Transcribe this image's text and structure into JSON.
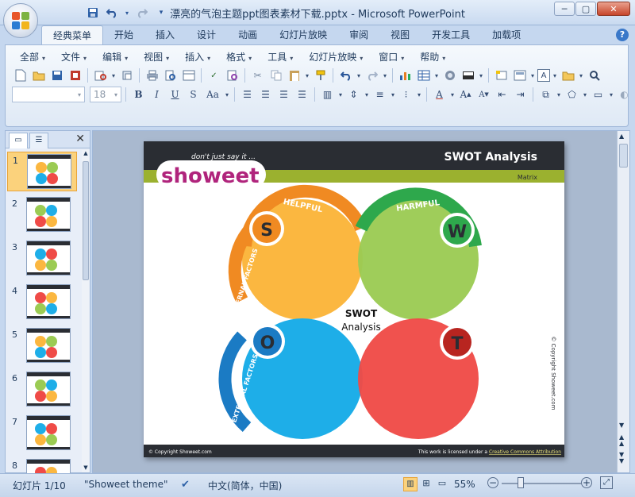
{
  "window": {
    "title": "漂亮的气泡主题ppt图表素材下载.pptx - Microsoft PowerPoint",
    "controls": {
      "minimize": "─",
      "maximize": "▢",
      "close": "✕"
    }
  },
  "quick_access": [
    "save-icon",
    "undo-icon",
    "redo-icon",
    "customize-icon"
  ],
  "ribbon_tabs": [
    {
      "label": "经典菜单",
      "active": true
    },
    {
      "label": "开始"
    },
    {
      "label": "插入"
    },
    {
      "label": "设计"
    },
    {
      "label": "动画"
    },
    {
      "label": "幻灯片放映"
    },
    {
      "label": "审阅"
    },
    {
      "label": "视图"
    },
    {
      "label": "开发工具"
    },
    {
      "label": "加载项"
    }
  ],
  "classic_menu": [
    {
      "label": "全部"
    },
    {
      "label": "文件"
    },
    {
      "label": "编辑"
    },
    {
      "label": "视图"
    },
    {
      "label": "插入"
    },
    {
      "label": "格式"
    },
    {
      "label": "工具"
    },
    {
      "label": "幻灯片放映"
    },
    {
      "label": "窗口"
    },
    {
      "label": "帮助"
    }
  ],
  "font_box": {
    "name": "",
    "size": "18"
  },
  "slide_pane": {
    "thumbnails": [
      {
        "num": "1",
        "selected": true
      },
      {
        "num": "2"
      },
      {
        "num": "3"
      },
      {
        "num": "4"
      },
      {
        "num": "5"
      },
      {
        "num": "6"
      },
      {
        "num": "7"
      },
      {
        "num": "8"
      }
    ]
  },
  "slide": {
    "brand_tagline": "don't just say it ...",
    "brand_logo": "showeet",
    "heading": "SWOT Analysis",
    "subheading": "Matrix",
    "center_title": "SWOT",
    "center_subtitle": "Analysis",
    "arc_labels": {
      "helpful": "HELPFUL",
      "harmful": "HARMFUL",
      "internal": "INTERNAL FACTORS",
      "external": "EXTERNAL FACTORS"
    },
    "quadrants": [
      {
        "letter": "S",
        "color": "#fbb740",
        "badge": "#f08a22"
      },
      {
        "letter": "W",
        "color": "#9bcb53",
        "badge": "#2ea84c"
      },
      {
        "letter": "O",
        "color": "#1eaee8",
        "badge": "#1b7bc4"
      },
      {
        "letter": "T",
        "color": "#ef4b47",
        "badge": "#b82520"
      }
    ],
    "side_copyright": "© Copyright Showeet.com",
    "footer_left": "© Copyright Showeet.com",
    "footer_right_prefix": "This work is licensed under a ",
    "footer_right_link": "Creative Commons Attribution"
  },
  "status": {
    "slide_info": "幻灯片 1/10",
    "theme": "\"Showeet theme\"",
    "language": "中文(简体，中国)",
    "zoom": "55%"
  }
}
